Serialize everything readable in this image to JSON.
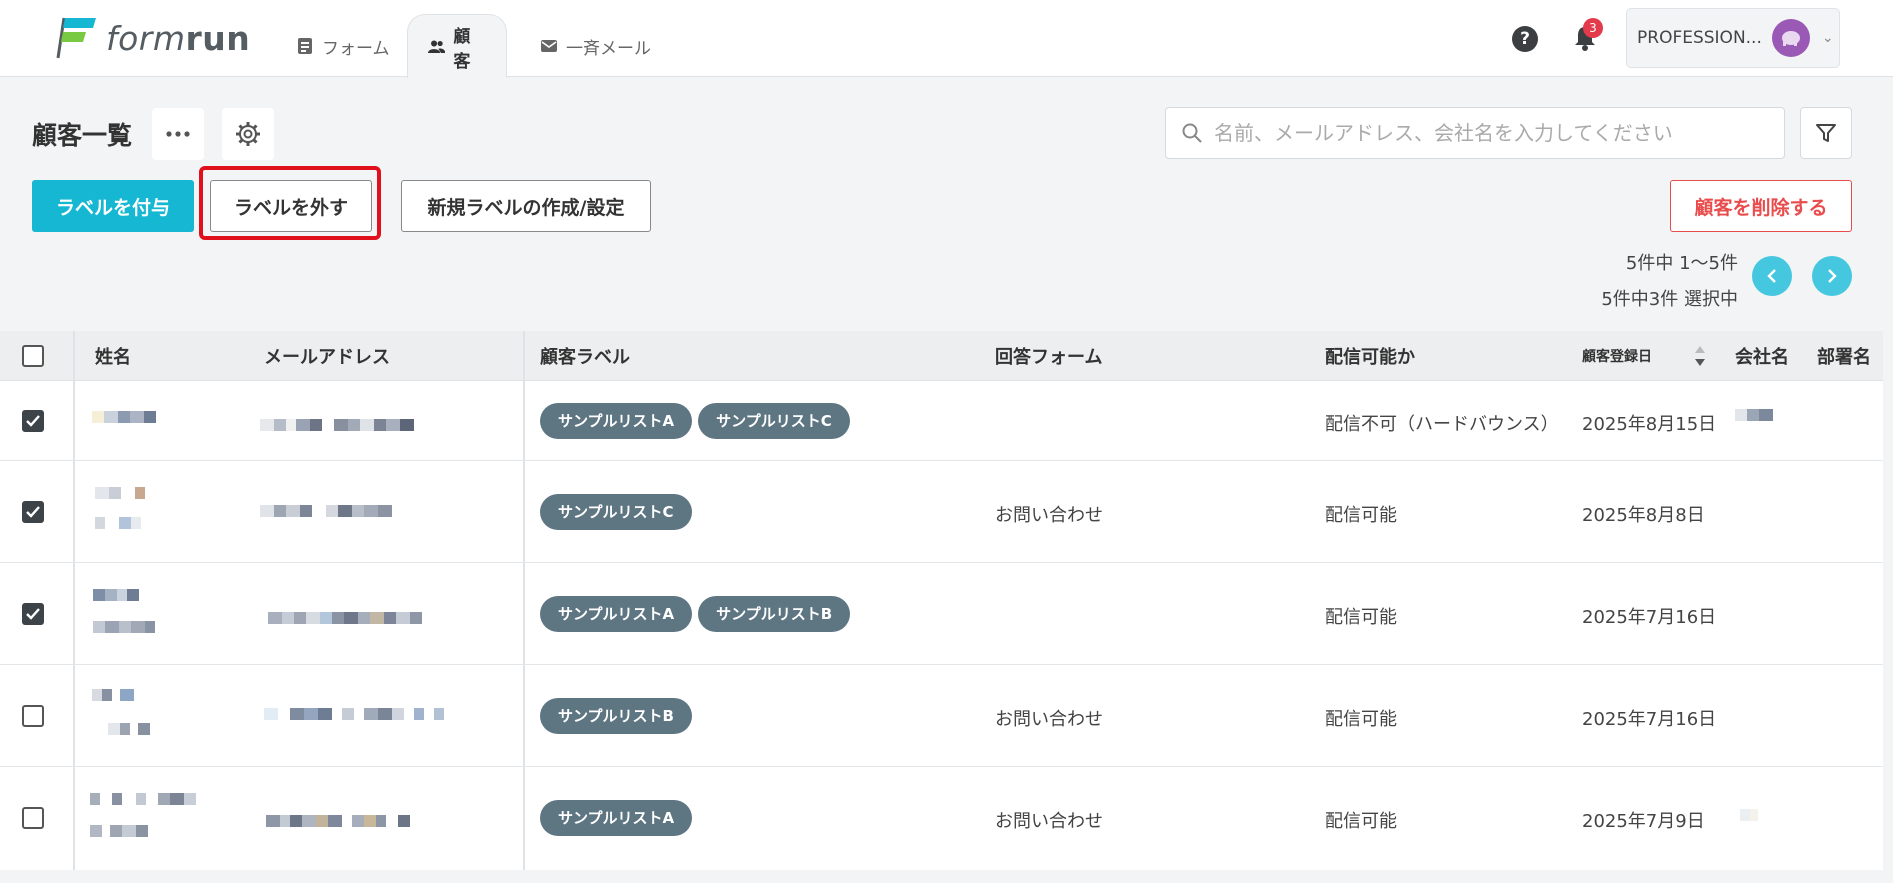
{
  "header": {
    "logo_text_light": "form",
    "logo_text_bold": "run",
    "tabs": [
      {
        "label": "フォーム",
        "icon": "form-icon"
      },
      {
        "label": "顧客",
        "icon": "people-icon"
      },
      {
        "label": "一斉メール",
        "icon": "mail-icon"
      }
    ],
    "help_label": "?",
    "notification_count": "3",
    "account_label": "PROFESSION...",
    "colors": {
      "accent": "#15b7d3",
      "badge": "#e33b4c"
    }
  },
  "toolbar": {
    "page_title": "顧客一覧",
    "more_icon": "more-icon",
    "settings_icon": "gear-icon",
    "search_placeholder": "名前、メールアドレス、会社名を入力してください",
    "add_label_button": "ラベルを付与",
    "remove_label_button": "ラベルを外す",
    "new_label_button": "新規ラベルの作成/設定",
    "delete_button": "顧客を削除する",
    "paging_range": "5件中 1～5件",
    "selection_status": "5件中3件 選択中",
    "prev_icon": "chevron-left-icon",
    "next_icon": "chevron-right-icon"
  },
  "table": {
    "headers": {
      "name": "姓名",
      "email": "メールアドレス",
      "labels": "顧客ラベル",
      "form": "回答フォーム",
      "deliverable": "配信可能か",
      "registered": "顧客登録日",
      "company": "会社名",
      "department": "部署名"
    },
    "rows": [
      {
        "checked": true,
        "labels": [
          "サンプルリストA",
          "サンプルリストC"
        ],
        "form": "",
        "deliverable": "配信不可（ハードバウンス）",
        "registered": "2025年8月15日"
      },
      {
        "checked": true,
        "labels": [
          "サンプルリストC"
        ],
        "form": "お問い合わせ",
        "deliverable": "配信可能",
        "registered": "2025年8月8日"
      },
      {
        "checked": true,
        "labels": [
          "サンプルリストA",
          "サンプルリストB"
        ],
        "form": "",
        "deliverable": "配信可能",
        "registered": "2025年7月16日"
      },
      {
        "checked": false,
        "labels": [
          "サンプルリストB"
        ],
        "form": "お問い合わせ",
        "deliverable": "配信可能",
        "registered": "2025年7月16日"
      },
      {
        "checked": false,
        "labels": [
          "サンプルリストA"
        ],
        "form": "お問い合わせ",
        "deliverable": "配信可能",
        "registered": "2025年7月9日"
      }
    ]
  }
}
